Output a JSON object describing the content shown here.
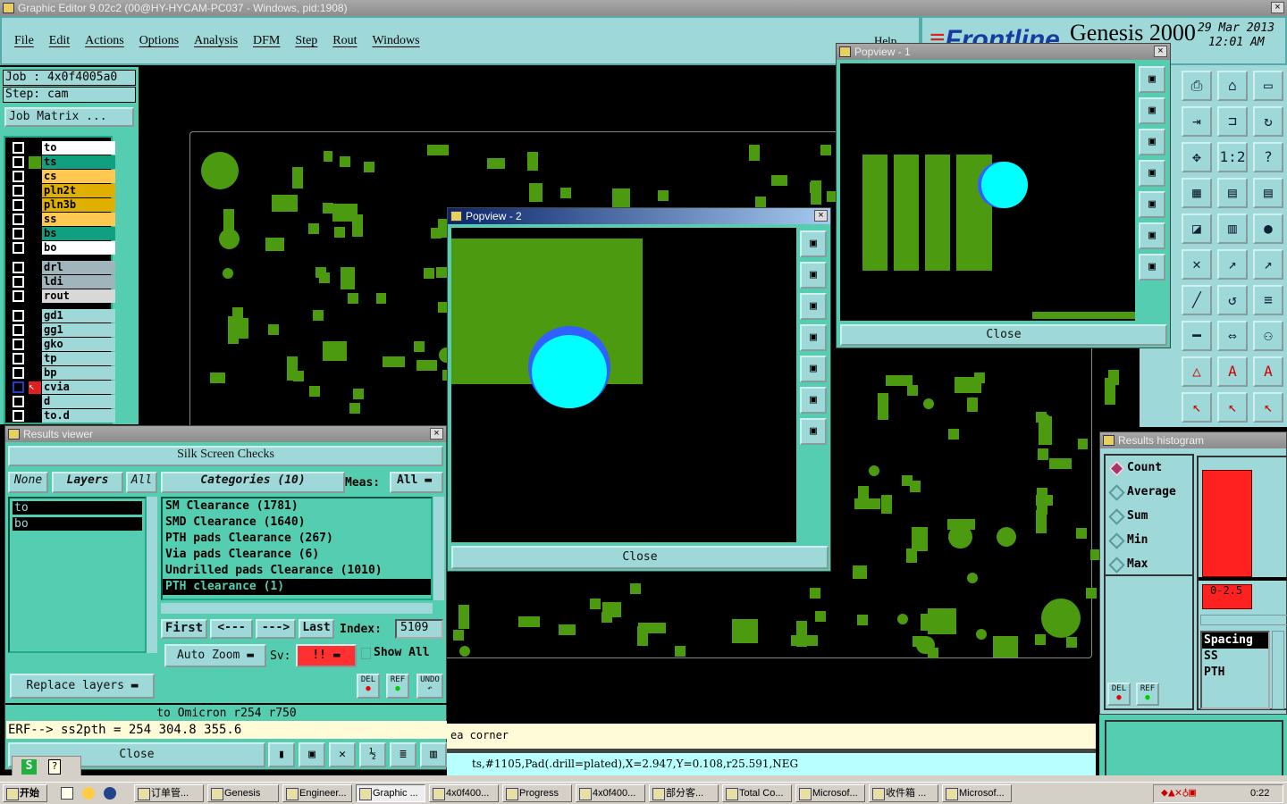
{
  "window": {
    "title": "Graphic Editor 9.02c2 (00@HY-HYCAM-PC037 - Windows, pid:1908)"
  },
  "menu": [
    "File",
    "Edit",
    "Actions",
    "Options",
    "Analysis",
    "DFM",
    "Step",
    "Rout",
    "Windows"
  ],
  "help": "Help",
  "brand": {
    "logo": "Frontline",
    "product": "Genesis 2000",
    "date": "29 Mar 2013",
    "time": "12:01 AM"
  },
  "job": {
    "job": "Job  :  4x0f4005a0",
    "step": "Step:  cam",
    "matrix": "Job Matrix ..."
  },
  "layers": [
    {
      "name": "to",
      "color": "#ffffff"
    },
    {
      "name": "ts",
      "color": "#10a080"
    },
    {
      "name": "cs",
      "color": "#ffc850"
    },
    {
      "name": "pln2t",
      "color": "#e0b000"
    },
    {
      "name": "pln3b",
      "color": "#e0b000"
    },
    {
      "name": "ss",
      "color": "#ffc850"
    },
    {
      "name": "bs",
      "color": "#10a080"
    },
    {
      "name": "bo",
      "color": "#ffffff"
    },
    {
      "name": "drl",
      "color": "#a0b4bc"
    },
    {
      "name": "ldi",
      "color": "#a0b4bc"
    },
    {
      "name": "rout",
      "color": "#d8d8d8"
    },
    {
      "name": "gd1",
      "color": "#9ed8d8"
    },
    {
      "name": "gg1",
      "color": "#9ed8d8"
    },
    {
      "name": "gko",
      "color": "#9ed8d8"
    },
    {
      "name": "tp",
      "color": "#9ed8d8"
    },
    {
      "name": "bp",
      "color": "#9ed8d8"
    },
    {
      "name": "cvia",
      "color": "#9ed8d8"
    },
    {
      "name": "d",
      "color": "#9ed8d8"
    },
    {
      "name": "to.d",
      "color": "#9ed8d8"
    }
  ],
  "popview1": {
    "title": "Popview - 1",
    "close": "Close"
  },
  "popview2": {
    "title": "Popview - 2",
    "close": "Close"
  },
  "results": {
    "title": "Results viewer",
    "header": "Silk Screen Checks",
    "none": "None",
    "layers": "Layers",
    "all": "All",
    "layer_items": [
      "to",
      "bo"
    ],
    "categories": "Categories (10)",
    "meas_label": "Meas:",
    "meas_value": "All",
    "category_items": [
      "SM Clearance (1781)",
      "SMD Clearance (1640)",
      "PTH pads Clearance (267)",
      "Via pads Clearance (6)",
      "Undrilled pads Clearance (1010)",
      "PTH clearance (1)"
    ],
    "first": "First",
    "prev": "<---",
    "next": "--->",
    "last": "Last",
    "index_label": "Index:",
    "index": "5109",
    "auto_zoom": "Auto Zoom",
    "sv_label": "Sv:",
    "sv_value": "!!",
    "show_all": "Show All",
    "replace": "Replace layers",
    "del": "DEL",
    "ref": "REF",
    "undo": "UNDO",
    "info": "to Omicron  r254  r750",
    "erf": "ERF--> ss2pth = 254 304.8 355.6",
    "close": "Close"
  },
  "histogram": {
    "title": "Results histogram",
    "modes": [
      "Count",
      "Average",
      "Sum",
      "Min",
      "Max"
    ],
    "selected": "Count",
    "chart_data": {
      "type": "bar",
      "categories": [
        "0-2.5"
      ],
      "values": [
        1
      ]
    },
    "list": [
      "Spacing",
      "SS",
      "PTH"
    ],
    "del": "DEL",
    "ref": "REF"
  },
  "message": "ea corner",
  "status": "ts,#1105,Pad(.drill=plated),X=2.947,Y=0.108,r25.591,NEG",
  "taskbar": {
    "start": "开始",
    "items": [
      "订单管...",
      "Genesis",
      "Engineer...",
      "Graphic ...",
      "4x0f400...",
      "Progress",
      "4x0f400...",
      "部分客...",
      "Total Co...",
      "Microsof...",
      "收件箱 ...",
      "Microsof..."
    ],
    "clock": "0:22"
  },
  "colors": {
    "panel": "#9ed8d8",
    "teal": "#55cdb0",
    "copper": "#4c9a10",
    "highlight": "#00ffff",
    "bar": "#ff2020"
  }
}
